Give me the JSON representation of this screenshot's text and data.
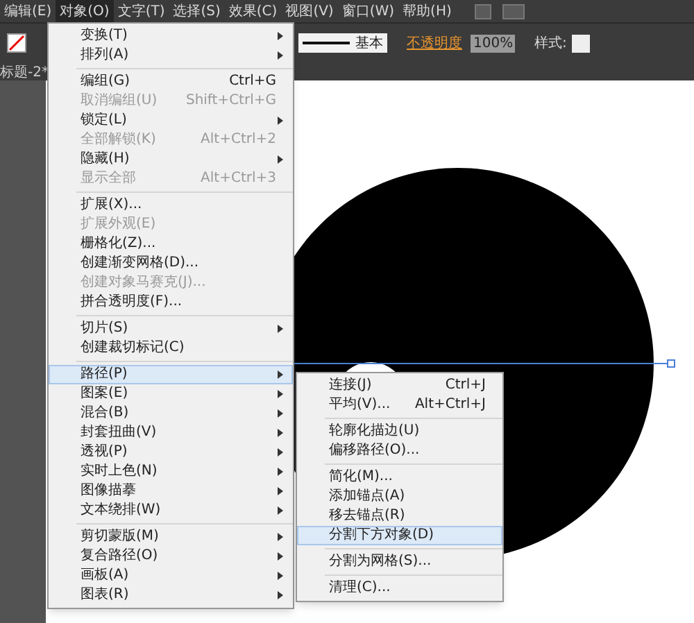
{
  "menu_bar": [
    {
      "label": "编辑(E)",
      "selected": false
    },
    {
      "label": "对象(O)",
      "selected": true
    },
    {
      "label": "文字(T)",
      "selected": false
    },
    {
      "label": "选择(S)",
      "selected": false
    },
    {
      "label": "效果(C)",
      "selected": false
    },
    {
      "label": "视图(V)",
      "selected": false
    },
    {
      "label": "窗口(W)",
      "selected": false
    },
    {
      "label": "帮助(H)",
      "selected": false
    }
  ],
  "control_bar": {
    "stroke_profile": "基本",
    "opacity_label": "不透明度",
    "opacity_value": "100%",
    "style_label": "样式:"
  },
  "document_tab": "标题-2*",
  "object_menu": [
    [
      {
        "label": "变换(T)",
        "submenu": true,
        "disabled": false,
        "selected": false
      },
      {
        "label": "排列(A)",
        "submenu": true,
        "disabled": false,
        "selected": false
      }
    ],
    [
      {
        "label": "编组(G)",
        "shortcut": "Ctrl+G",
        "submenu": false,
        "disabled": false,
        "selected": false
      },
      {
        "label": "取消编组(U)",
        "shortcut": "Shift+Ctrl+G",
        "submenu": false,
        "disabled": true,
        "selected": false
      },
      {
        "label": "锁定(L)",
        "submenu": true,
        "disabled": false,
        "selected": false
      },
      {
        "label": "全部解锁(K)",
        "shortcut": "Alt+Ctrl+2",
        "submenu": false,
        "disabled": true,
        "selected": false
      },
      {
        "label": "隐藏(H)",
        "submenu": true,
        "disabled": false,
        "selected": false
      },
      {
        "label": "显示全部",
        "shortcut": "Alt+Ctrl+3",
        "submenu": false,
        "disabled": true,
        "selected": false
      }
    ],
    [
      {
        "label": "扩展(X)...",
        "submenu": false,
        "disabled": false,
        "selected": false
      },
      {
        "label": "扩展外观(E)",
        "submenu": false,
        "disabled": true,
        "selected": false
      },
      {
        "label": "栅格化(Z)...",
        "submenu": false,
        "disabled": false,
        "selected": false
      },
      {
        "label": "创建渐变网格(D)...",
        "submenu": false,
        "disabled": false,
        "selected": false
      },
      {
        "label": "创建对象马赛克(J)...",
        "submenu": false,
        "disabled": true,
        "selected": false
      },
      {
        "label": "拼合透明度(F)...",
        "submenu": false,
        "disabled": false,
        "selected": false
      }
    ],
    [
      {
        "label": "切片(S)",
        "submenu": true,
        "disabled": false,
        "selected": false
      },
      {
        "label": "创建裁切标记(C)",
        "submenu": false,
        "disabled": false,
        "selected": false
      }
    ],
    [
      {
        "label": "路径(P)",
        "submenu": true,
        "disabled": false,
        "selected": true
      },
      {
        "label": "图案(E)",
        "submenu": true,
        "disabled": false,
        "selected": false
      },
      {
        "label": "混合(B)",
        "submenu": true,
        "disabled": false,
        "selected": false
      },
      {
        "label": "封套扭曲(V)",
        "submenu": true,
        "disabled": false,
        "selected": false
      },
      {
        "label": "透视(P)",
        "submenu": true,
        "disabled": false,
        "selected": false
      },
      {
        "label": "实时上色(N)",
        "submenu": true,
        "disabled": false,
        "selected": false
      },
      {
        "label": "图像描摹",
        "submenu": true,
        "disabled": false,
        "selected": false
      },
      {
        "label": "文本绕排(W)",
        "submenu": true,
        "disabled": false,
        "selected": false
      }
    ],
    [
      {
        "label": "剪切蒙版(M)",
        "submenu": true,
        "disabled": false,
        "selected": false
      },
      {
        "label": "复合路径(O)",
        "submenu": true,
        "disabled": false,
        "selected": false
      },
      {
        "label": "画板(A)",
        "submenu": true,
        "disabled": false,
        "selected": false
      },
      {
        "label": "图表(R)",
        "submenu": true,
        "disabled": false,
        "selected": false
      }
    ]
  ],
  "path_submenu": [
    [
      {
        "label": "连接(J)",
        "shortcut": "Ctrl+J",
        "submenu": false,
        "disabled": false,
        "selected": false
      },
      {
        "label": "平均(V)...",
        "shortcut": "Alt+Ctrl+J",
        "submenu": false,
        "disabled": false,
        "selected": false
      }
    ],
    [
      {
        "label": "轮廓化描边(U)",
        "submenu": false,
        "disabled": false,
        "selected": false
      },
      {
        "label": "偏移路径(O)...",
        "submenu": false,
        "disabled": false,
        "selected": false
      }
    ],
    [
      {
        "label": "简化(M)...",
        "submenu": false,
        "disabled": false,
        "selected": false
      },
      {
        "label": "添加锚点(A)",
        "submenu": false,
        "disabled": false,
        "selected": false
      },
      {
        "label": "移去锚点(R)",
        "submenu": false,
        "disabled": false,
        "selected": false
      },
      {
        "label": "分割下方对象(D)",
        "submenu": false,
        "disabled": false,
        "selected": true
      }
    ],
    [
      {
        "label": "分割为网格(S)...",
        "submenu": false,
        "disabled": false,
        "selected": false
      }
    ],
    [
      {
        "label": "清理(C)...",
        "submenu": false,
        "disabled": false,
        "selected": false
      }
    ]
  ]
}
